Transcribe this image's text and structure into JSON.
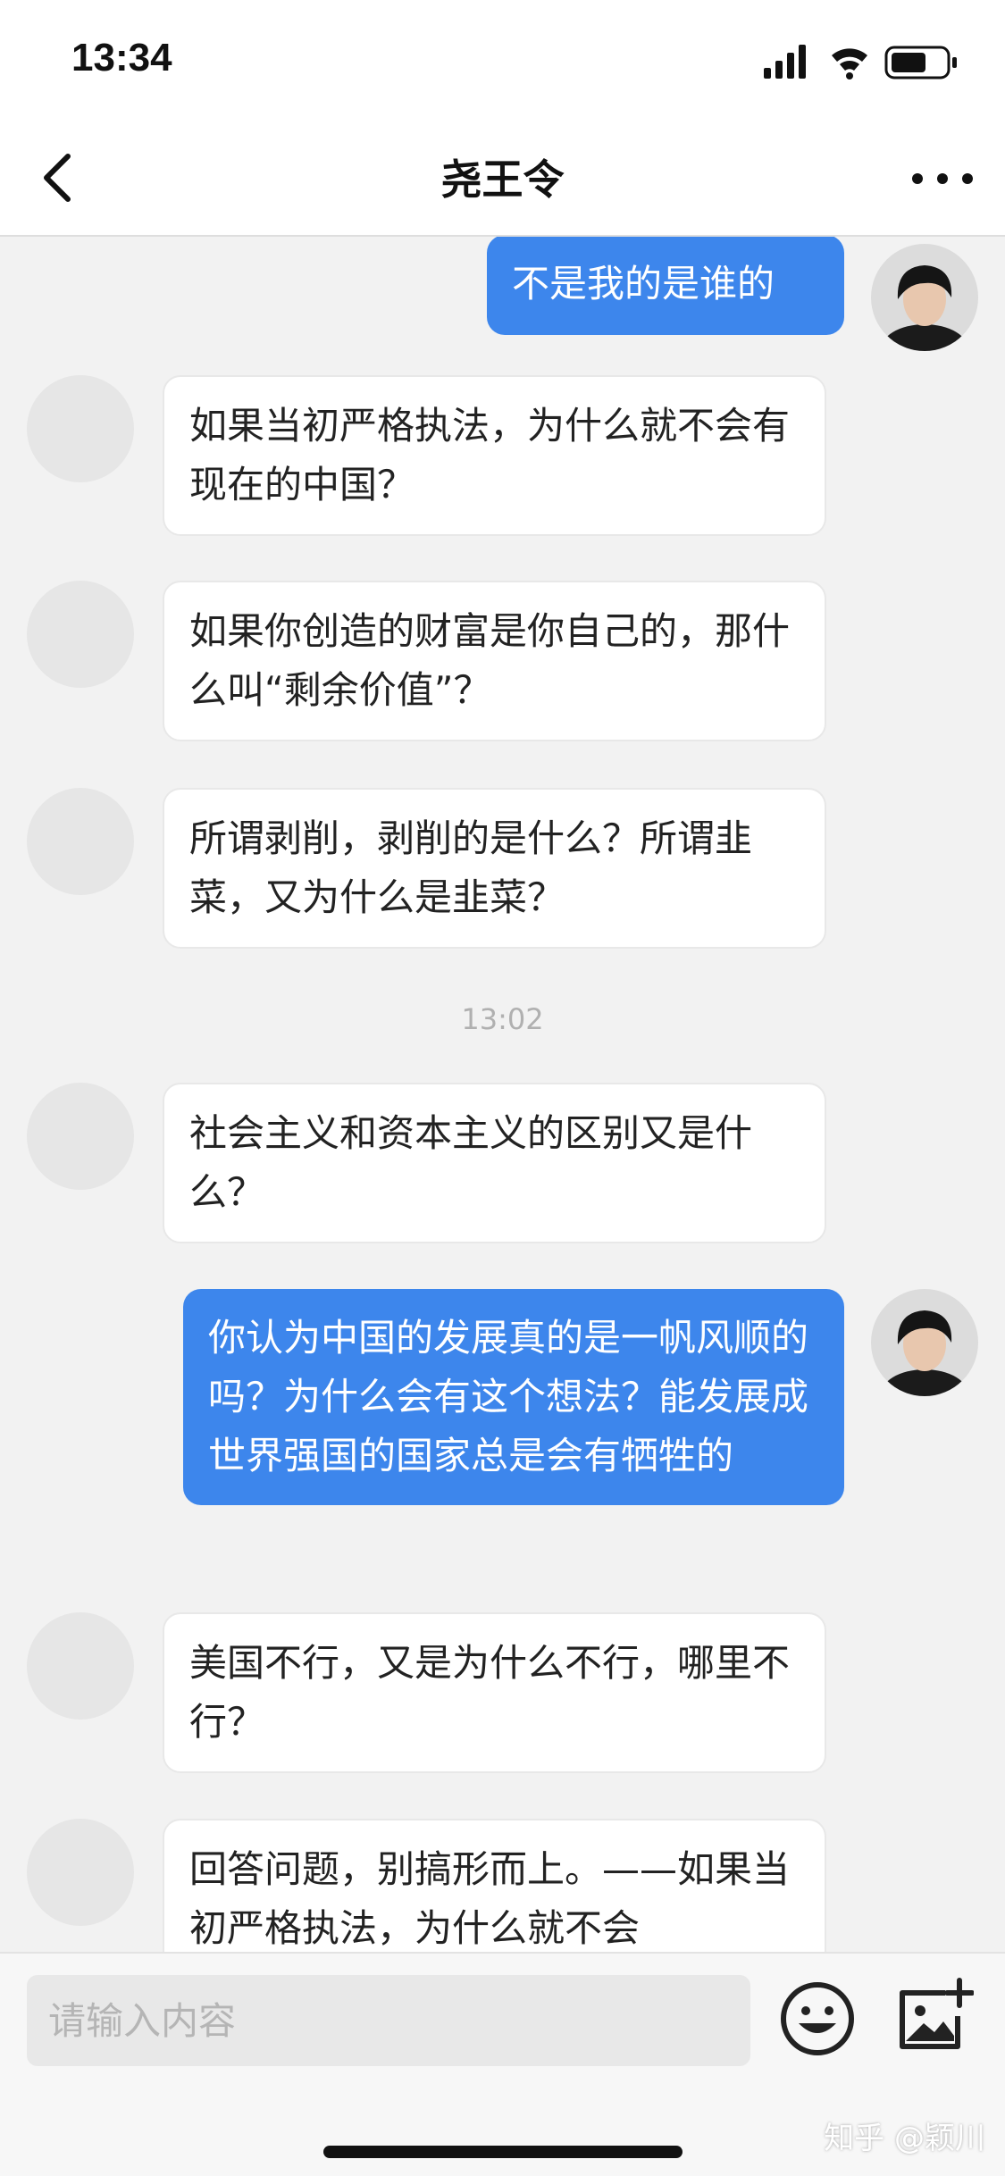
{
  "status_bar": {
    "time": "13:34"
  },
  "nav": {
    "title": "尧王令"
  },
  "messages": {
    "m0": "不是我的是谁的",
    "m1": "如果当初严格执法，为什么就不会有现在的中国？",
    "m2": "如果你创造的财富是你自己的，那什么叫“剩余价值”？",
    "m3": "所谓剥削，剥削的是什么？所谓韭菜，又为什么是韭菜？",
    "time_sep": "13:02",
    "m4": "社会主义和资本主义的区别又是什么？",
    "m5": "你认为中国的发展真的是一帆风顺的吗？为什么会有这个想法？能发展成世界强国的国家总是会有牺牲的",
    "m6": "美国不行，又是为什么不行，哪里不行？",
    "m7": "回答问题，别搞形而上。——如果当初严格执法，为什么就不会"
  },
  "input": {
    "placeholder": "请输入内容"
  },
  "watermark": "知乎 @颖川",
  "colors": {
    "outgoing_bubble": "#3d86ec",
    "incoming_bubble": "#ffffff",
    "background": "#f2f2f2"
  },
  "icons": [
    "back-arrow-icon",
    "more-dots-icon",
    "signal-icon",
    "wifi-icon",
    "battery-icon",
    "emoji-icon",
    "add-image-icon"
  ]
}
